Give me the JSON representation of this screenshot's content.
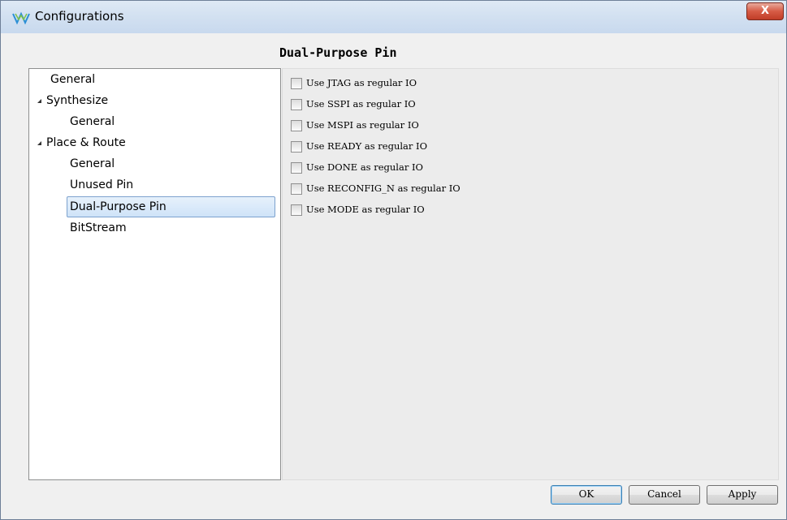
{
  "window": {
    "title": "Configurations",
    "close_glyph": "X"
  },
  "page": {
    "heading": "Dual-Purpose Pin"
  },
  "tree": {
    "items": [
      {
        "label": "General"
      },
      {
        "label": "Synthesize"
      },
      {
        "label": "General"
      },
      {
        "label": "Place & Route"
      },
      {
        "label": "General"
      },
      {
        "label": "Unused Pin"
      },
      {
        "label": "Dual-Purpose Pin"
      },
      {
        "label": "BitStream"
      }
    ]
  },
  "options": [
    {
      "label": "Use JTAG as regular IO",
      "checked": false
    },
    {
      "label": "Use SSPI as regular IO",
      "checked": false
    },
    {
      "label": "Use MSPI as regular IO",
      "checked": false
    },
    {
      "label": "Use READY as regular IO",
      "checked": false
    },
    {
      "label": "Use DONE as regular IO",
      "checked": false
    },
    {
      "label": "Use RECONFIG_N as regular IO",
      "checked": false
    },
    {
      "label": "Use MODE as regular IO",
      "checked": false
    }
  ],
  "buttons": {
    "ok": "OK",
    "cancel": "Cancel",
    "apply": "Apply"
  },
  "colors": {
    "selection": "#cfe3f8",
    "close": "#c13d27"
  }
}
